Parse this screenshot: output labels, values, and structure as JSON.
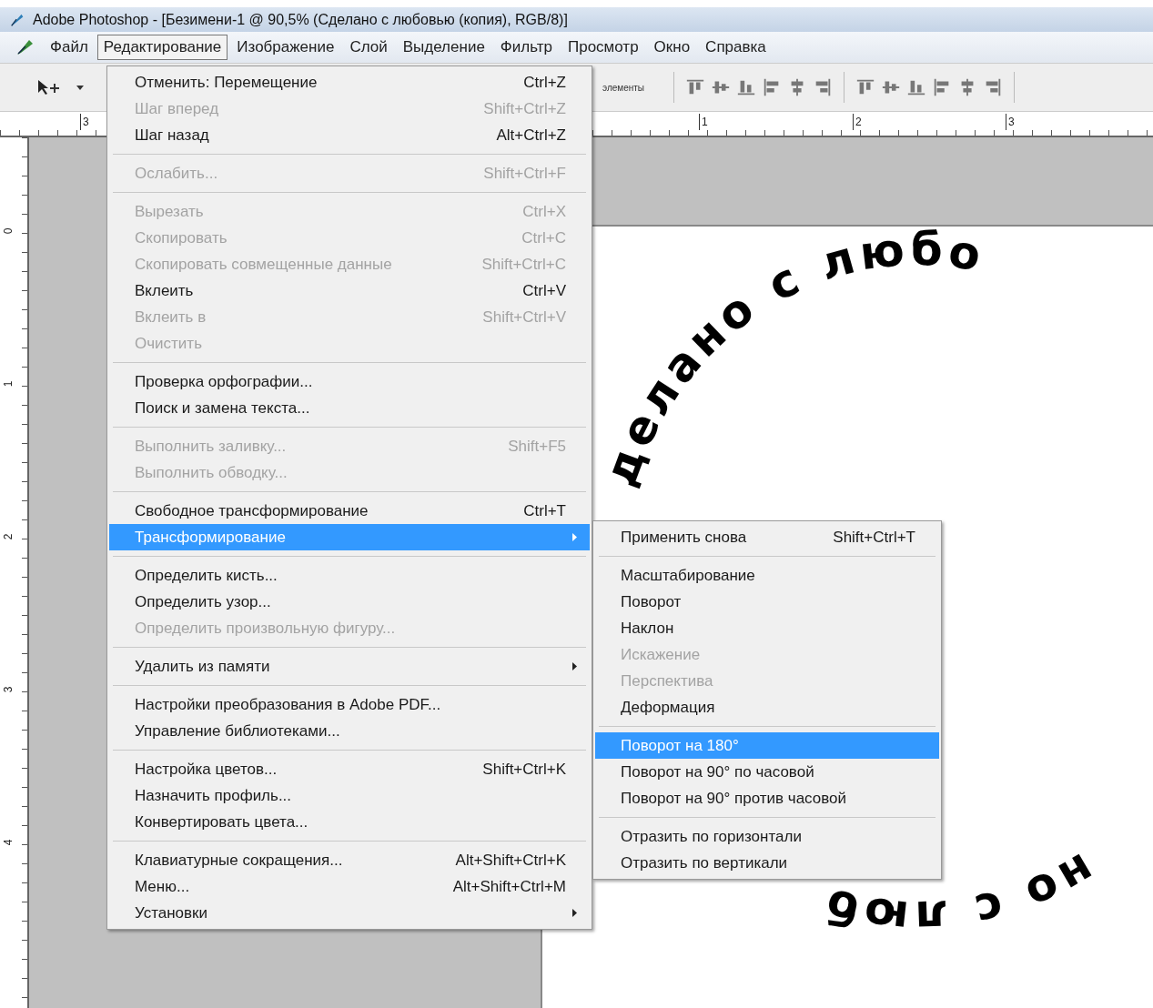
{
  "window": {
    "title": "Adobe Photoshop - [Безимени-1 @ 90,5% (Сделано с любовью  (копия), RGB/8)]"
  },
  "menubar": [
    {
      "label": "Файл",
      "selected": false
    },
    {
      "label": "Редактирование",
      "selected": true
    },
    {
      "label": "Изображение",
      "selected": false
    },
    {
      "label": "Слой",
      "selected": false
    },
    {
      "label": "Выделение",
      "selected": false
    },
    {
      "label": "Фильтр",
      "selected": false
    },
    {
      "label": "Просмотр",
      "selected": false
    },
    {
      "label": "Окно",
      "selected": false
    },
    {
      "label": "Справка",
      "selected": false
    }
  ],
  "toolbar": {
    "option_label": "элементы"
  },
  "horizontal_ruler": [
    "3",
    "1",
    "2",
    "3"
  ],
  "vertical_ruler": [
    "0",
    "1",
    "2",
    "3",
    "4"
  ],
  "canvas": {
    "text_top": "делано с любо",
    "text_bottom": "но с люб"
  },
  "edit_menu": [
    {
      "kind": "item",
      "label": "Отменить: Перемещение",
      "shortcut": "Ctrl+Z",
      "disabled": false,
      "selected": false
    },
    {
      "kind": "item",
      "label": "Шаг вперед",
      "shortcut": "Shift+Ctrl+Z",
      "disabled": true,
      "selected": false
    },
    {
      "kind": "item",
      "label": "Шаг назад",
      "shortcut": "Alt+Ctrl+Z",
      "disabled": false,
      "selected": false
    },
    {
      "kind": "separator"
    },
    {
      "kind": "item",
      "label": "Ослабить...",
      "shortcut": "Shift+Ctrl+F",
      "disabled": true,
      "selected": false
    },
    {
      "kind": "separator"
    },
    {
      "kind": "item",
      "label": "Вырезать",
      "shortcut": "Ctrl+X",
      "disabled": true,
      "selected": false
    },
    {
      "kind": "item",
      "label": "Скопировать",
      "shortcut": "Ctrl+C",
      "disabled": true,
      "selected": false
    },
    {
      "kind": "item",
      "label": "Скопировать совмещенные данные",
      "shortcut": "Shift+Ctrl+C",
      "disabled": true,
      "selected": false
    },
    {
      "kind": "item",
      "label": "Вклеить",
      "shortcut": "Ctrl+V",
      "disabled": false,
      "selected": false
    },
    {
      "kind": "item",
      "label": "Вклеить в",
      "shortcut": "Shift+Ctrl+V",
      "disabled": true,
      "selected": false
    },
    {
      "kind": "item",
      "label": "Очистить",
      "disabled": true,
      "selected": false
    },
    {
      "kind": "separator"
    },
    {
      "kind": "item",
      "label": "Проверка орфографии...",
      "disabled": false,
      "selected": false
    },
    {
      "kind": "item",
      "label": "Поиск и замена текста...",
      "disabled": false,
      "selected": false
    },
    {
      "kind": "separator"
    },
    {
      "kind": "item",
      "label": "Выполнить заливку...",
      "shortcut": "Shift+F5",
      "disabled": true,
      "selected": false
    },
    {
      "kind": "item",
      "label": "Выполнить обводку...",
      "disabled": true,
      "selected": false
    },
    {
      "kind": "separator"
    },
    {
      "kind": "item",
      "label": "Свободное трансформирование",
      "shortcut": "Ctrl+T",
      "disabled": false,
      "selected": false
    },
    {
      "kind": "submenu",
      "label": "Трансформирование",
      "disabled": false,
      "selected": true
    },
    {
      "kind": "separator"
    },
    {
      "kind": "item",
      "label": "Определить кисть...",
      "disabled": false,
      "selected": false
    },
    {
      "kind": "item",
      "label": "Определить узор...",
      "disabled": false,
      "selected": false
    },
    {
      "kind": "item",
      "label": "Определить произвольную фигуру...",
      "disabled": true,
      "selected": false
    },
    {
      "kind": "separator"
    },
    {
      "kind": "submenu",
      "label": "Удалить из памяти",
      "disabled": false,
      "selected": false
    },
    {
      "kind": "separator"
    },
    {
      "kind": "item",
      "label": "Настройки преобразования в Adobe PDF...",
      "disabled": false,
      "selected": false
    },
    {
      "kind": "item",
      "label": "Управление библиотеками...",
      "disabled": false,
      "selected": false
    },
    {
      "kind": "separator"
    },
    {
      "kind": "item",
      "label": "Настройка цветов...",
      "shortcut": "Shift+Ctrl+K",
      "disabled": false,
      "selected": false
    },
    {
      "kind": "item",
      "label": "Назначить профиль...",
      "disabled": false,
      "selected": false
    },
    {
      "kind": "item",
      "label": "Конвертировать цвета...",
      "disabled": false,
      "selected": false
    },
    {
      "kind": "separator"
    },
    {
      "kind": "item",
      "label": "Клавиатурные сокращения...",
      "shortcut": "Alt+Shift+Ctrl+K",
      "disabled": false,
      "selected": false
    },
    {
      "kind": "item",
      "label": "Меню...",
      "shortcut": "Alt+Shift+Ctrl+M",
      "disabled": false,
      "selected": false
    },
    {
      "kind": "submenu",
      "label": "Установки",
      "disabled": false,
      "selected": false
    }
  ],
  "transform_submenu": [
    {
      "kind": "item",
      "label": "Применить снова",
      "shortcut": "Shift+Ctrl+T",
      "disabled": false,
      "selected": false
    },
    {
      "kind": "separator"
    },
    {
      "kind": "item",
      "label": "Масштабирование",
      "disabled": false,
      "selected": false
    },
    {
      "kind": "item",
      "label": "Поворот",
      "disabled": false,
      "selected": false
    },
    {
      "kind": "item",
      "label": "Наклон",
      "disabled": false,
      "selected": false
    },
    {
      "kind": "item",
      "label": "Искажение",
      "disabled": true,
      "selected": false
    },
    {
      "kind": "item",
      "label": "Перспектива",
      "disabled": true,
      "selected": false
    },
    {
      "kind": "item",
      "label": "Деформация",
      "disabled": false,
      "selected": false
    },
    {
      "kind": "separator"
    },
    {
      "kind": "item",
      "label": "Поворот на 180°",
      "disabled": false,
      "selected": true
    },
    {
      "kind": "item",
      "label": "Поворот на 90° по часовой",
      "disabled": false,
      "selected": false
    },
    {
      "kind": "item",
      "label": "Поворот на 90° против часовой",
      "disabled": false,
      "selected": false
    },
    {
      "kind": "separator"
    },
    {
      "kind": "item",
      "label": "Отразить по горизонтали",
      "disabled": false,
      "selected": false
    },
    {
      "kind": "item",
      "label": "Отразить по вертикали",
      "disabled": false,
      "selected": false
    }
  ]
}
